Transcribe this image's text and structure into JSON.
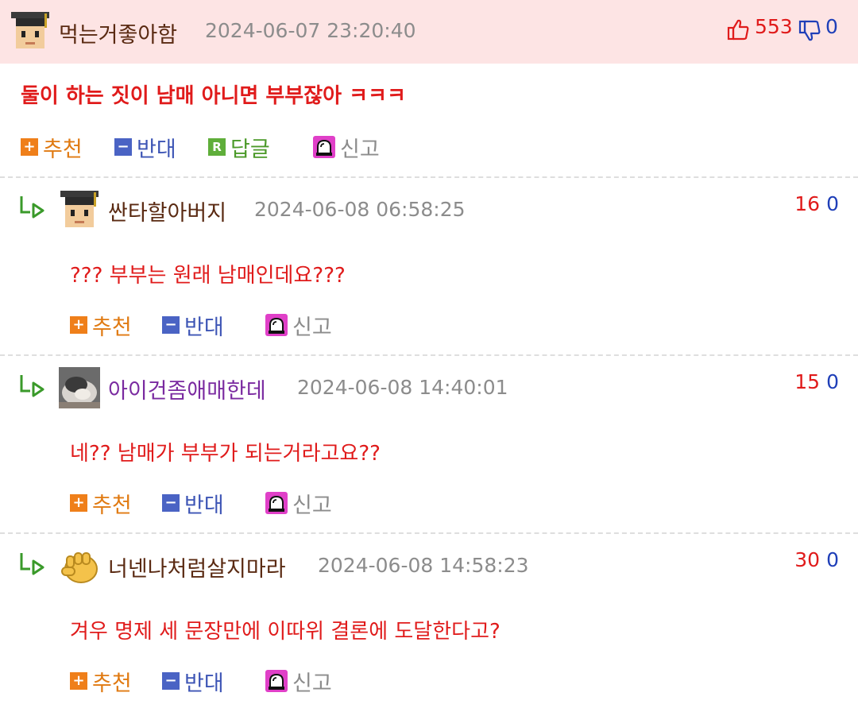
{
  "main_comment": {
    "author": "먹는거좋아함",
    "date": "2024-06-07 23:20:40",
    "upvotes": "553",
    "downvotes": "0",
    "text": "둘이 하는 짓이 남매 아니면 부부잖아 ㅋㅋㅋ",
    "actions": {
      "recommend": "추천",
      "oppose": "반대",
      "reply": "답글",
      "report": "신고"
    }
  },
  "replies": [
    {
      "author": "싼타할아버지",
      "date": "2024-06-08 06:58:25",
      "upvotes": "16",
      "downvotes": "0",
      "text": "??? 부부는 원래 남매인데요???",
      "author_color": "#5a2a12"
    },
    {
      "author": "아이건좀애매한데",
      "date": "2024-06-08 14:40:01",
      "upvotes": "15",
      "downvotes": "0",
      "text": "네?? 남매가 부부가 되는거라고요??",
      "author_color": "#7a2aa0"
    },
    {
      "author": "너넨나처럼살지마라",
      "date": "2024-06-08 14:58:23",
      "upvotes": "30",
      "downvotes": "0",
      "text": "겨우 명제 세 문장만에 이따위 결론에 도달한다고?",
      "author_color": "#5a2a12"
    }
  ],
  "reply_actions": {
    "recommend": "추천",
    "oppose": "반대",
    "report": "신고"
  },
  "colors": {
    "accent_red": "#e01b1b",
    "accent_blue": "#1f3fb8",
    "header_bg": "#fde4e4"
  },
  "icons": [
    "scholar-avatar-icon",
    "thumbs-up-icon",
    "thumbs-down-icon",
    "plus-icon",
    "minus-icon",
    "reply-r-icon",
    "siren-icon",
    "reply-arrow-icon",
    "photo-avatar",
    "fist-avatar-icon"
  ]
}
